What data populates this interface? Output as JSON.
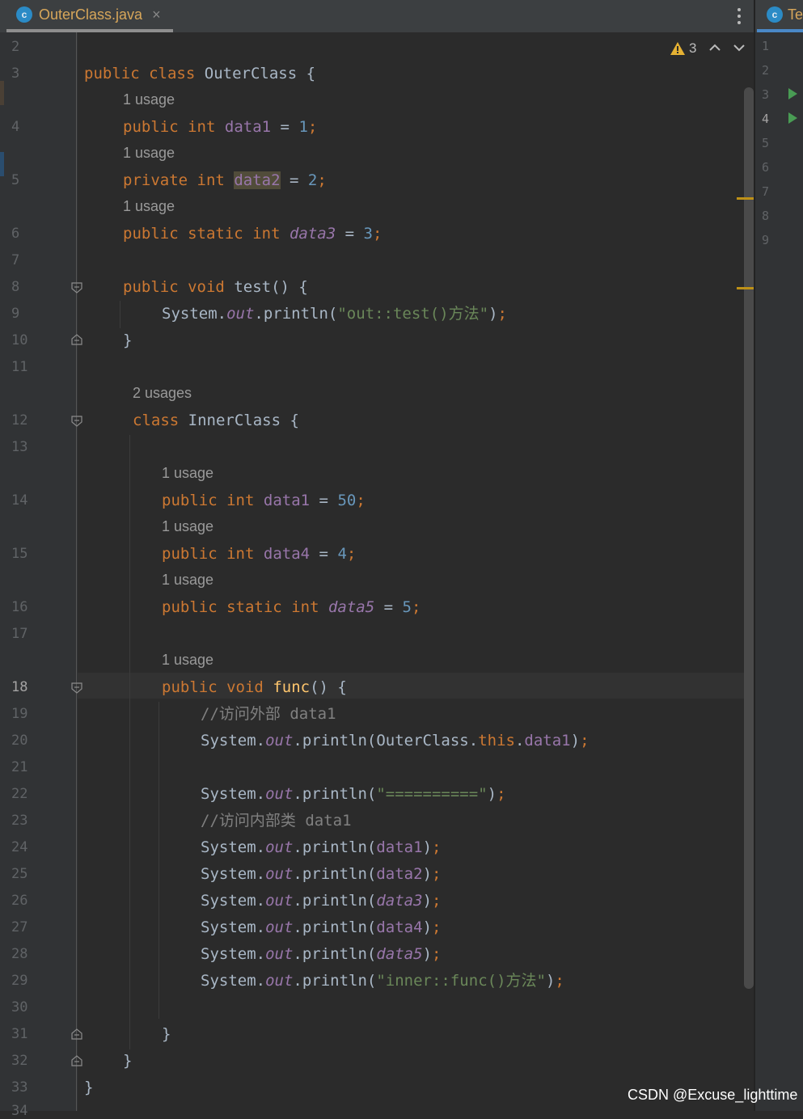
{
  "tab": {
    "icon": "c",
    "title": "OuterClass.java",
    "close": "×"
  },
  "right_tab": {
    "icon": "c",
    "title": "Te"
  },
  "inspections": {
    "warning_count": "3"
  },
  "gutter_lines": [
    "2",
    "3",
    "4",
    "5",
    "6",
    "7",
    "8",
    "9",
    "10",
    "11",
    "12",
    "13",
    "14",
    "15",
    "16",
    "17",
    "18",
    "19",
    "20",
    "21",
    "22",
    "23",
    "24",
    "25",
    "26",
    "27",
    "28",
    "29",
    "30",
    "31",
    "32",
    "33",
    "34"
  ],
  "current_line": "18",
  "right_gutter_lines": [
    "1",
    "2",
    "3",
    "4",
    "5",
    "6",
    "7",
    "8",
    "9"
  ],
  "hints": {
    "one_usage": "1 usage",
    "two_usages": "2 usages"
  },
  "code": {
    "l3": {
      "kw1": "public",
      "kw2": "class",
      "name": "OuterClass",
      "brace": "{"
    },
    "l4": {
      "kw1": "public",
      "kw2": "int",
      "field": "data1",
      "eq": "=",
      "num": "1",
      "semi": ";"
    },
    "l5": {
      "kw1": "private",
      "kw2": "int",
      "field": "data2",
      "eq": "=",
      "num": "2",
      "semi": ";"
    },
    "l6": {
      "kw1": "public",
      "kw2": "static",
      "kw3": "int",
      "field": "data3",
      "eq": "=",
      "num": "3",
      "semi": ";"
    },
    "l8": {
      "kw1": "public",
      "kw2": "void",
      "name": "test",
      "rest": "() {"
    },
    "l9": {
      "sys": "System.",
      "out": "out",
      "call": ".println(",
      "str": "\"out::test()方法\"",
      "close": ")",
      "semi": ";"
    },
    "l10": {
      "brace": "}"
    },
    "l12": {
      "kw1": "class",
      "name": "InnerClass",
      "brace": "{"
    },
    "l14": {
      "kw1": "public",
      "kw2": "int",
      "field": "data1",
      "eq": "=",
      "num": "50",
      "semi": ";"
    },
    "l15": {
      "kw1": "public",
      "kw2": "int",
      "field": "data4",
      "eq": "=",
      "num": "4",
      "semi": ";"
    },
    "l16": {
      "kw1": "public",
      "kw2": "static",
      "kw3": "int",
      "field": "data5",
      "eq": "=",
      "num": "5",
      "semi": ";"
    },
    "l18": {
      "kw1": "public",
      "kw2": "void",
      "name": "func",
      "rest": "() {"
    },
    "l19": {
      "comment": "//访问外部 data1"
    },
    "l20": {
      "sys": "System.",
      "out": "out",
      "call": ".println(OuterClass.",
      "kw": "this",
      "dot": ".",
      "field": "data1",
      "close": ")",
      "semi": ";"
    },
    "l22": {
      "sys": "System.",
      "out": "out",
      "call": ".println(",
      "str": "\"==========\"",
      "close": ")",
      "semi": ";"
    },
    "l23": {
      "comment": "//访问内部类 data1"
    },
    "l24": {
      "sys": "System.",
      "out": "out",
      "call": ".println(",
      "field": "data1",
      "close": ")",
      "semi": ";"
    },
    "l25": {
      "sys": "System.",
      "out": "out",
      "call": ".println(",
      "field": "data2",
      "close": ")",
      "semi": ";"
    },
    "l26": {
      "sys": "System.",
      "out": "out",
      "call": ".println(",
      "field": "data3",
      "close": ")",
      "semi": ";"
    },
    "l27": {
      "sys": "System.",
      "out": "out",
      "call": ".println(",
      "field": "data4",
      "close": ")",
      "semi": ";"
    },
    "l28": {
      "sys": "System.",
      "out": "out",
      "call": ".println(",
      "field": "data5",
      "close": ")",
      "semi": ";"
    },
    "l29": {
      "sys": "System.",
      "out": "out",
      "call": ".println(",
      "str": "\"inner::func()方法\"",
      "close": ")",
      "semi": ";"
    },
    "l31": {
      "brace": "}"
    },
    "l32": {
      "brace": "}"
    },
    "l33": {
      "brace": "}"
    }
  },
  "watermark": "CSDN @Excuse_lighttime"
}
